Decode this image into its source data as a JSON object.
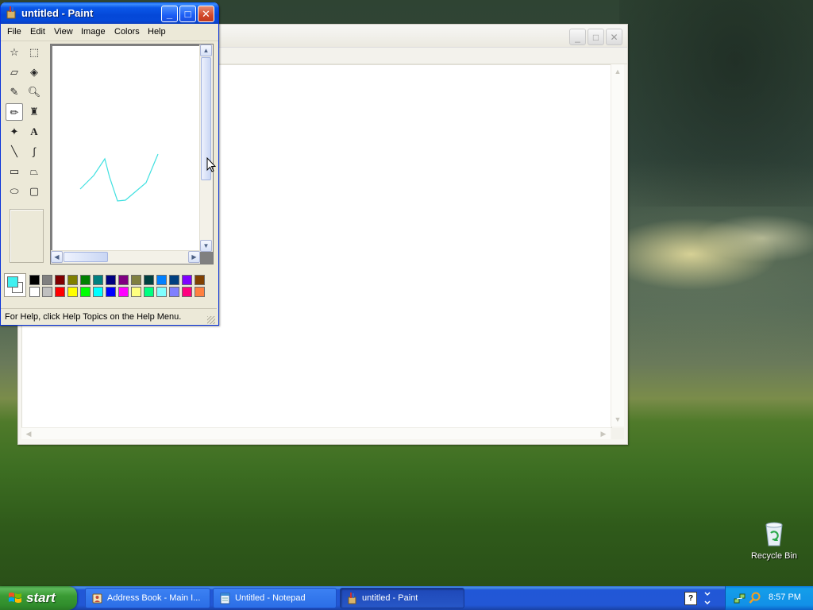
{
  "paint": {
    "title": "untitled - Paint",
    "menu": [
      "File",
      "Edit",
      "View",
      "Image",
      "Colors",
      "Help"
    ],
    "status": "For Help, click Help Topics on the Help Menu.",
    "selected_tool": "pencil",
    "foreground_color": "#40f0f0",
    "background_color": "#ffffff",
    "palette_top": [
      "#000000",
      "#808080",
      "#800000",
      "#808000",
      "#008000",
      "#008080",
      "#000080",
      "#800080",
      "#808040",
      "#004040",
      "#0080ff",
      "#004080",
      "#8000ff",
      "#804000"
    ],
    "palette_bottom": [
      "#ffffff",
      "#c0c0c0",
      "#ff0000",
      "#ffff00",
      "#00ff00",
      "#00ffff",
      "#0000ff",
      "#ff00ff",
      "#ffff80",
      "#00ff80",
      "#80ffff",
      "#8080ff",
      "#ff0080",
      "#ff8040"
    ]
  },
  "notepad": {},
  "desktop": {
    "recycle_bin_label": "Recycle Bin"
  },
  "taskbar": {
    "start_label": "start",
    "tasks": [
      {
        "label": "Address Book - Main I..."
      },
      {
        "label": "Untitled - Notepad"
      },
      {
        "label": "untitled - Paint"
      }
    ],
    "clock": "8:57 PM"
  }
}
